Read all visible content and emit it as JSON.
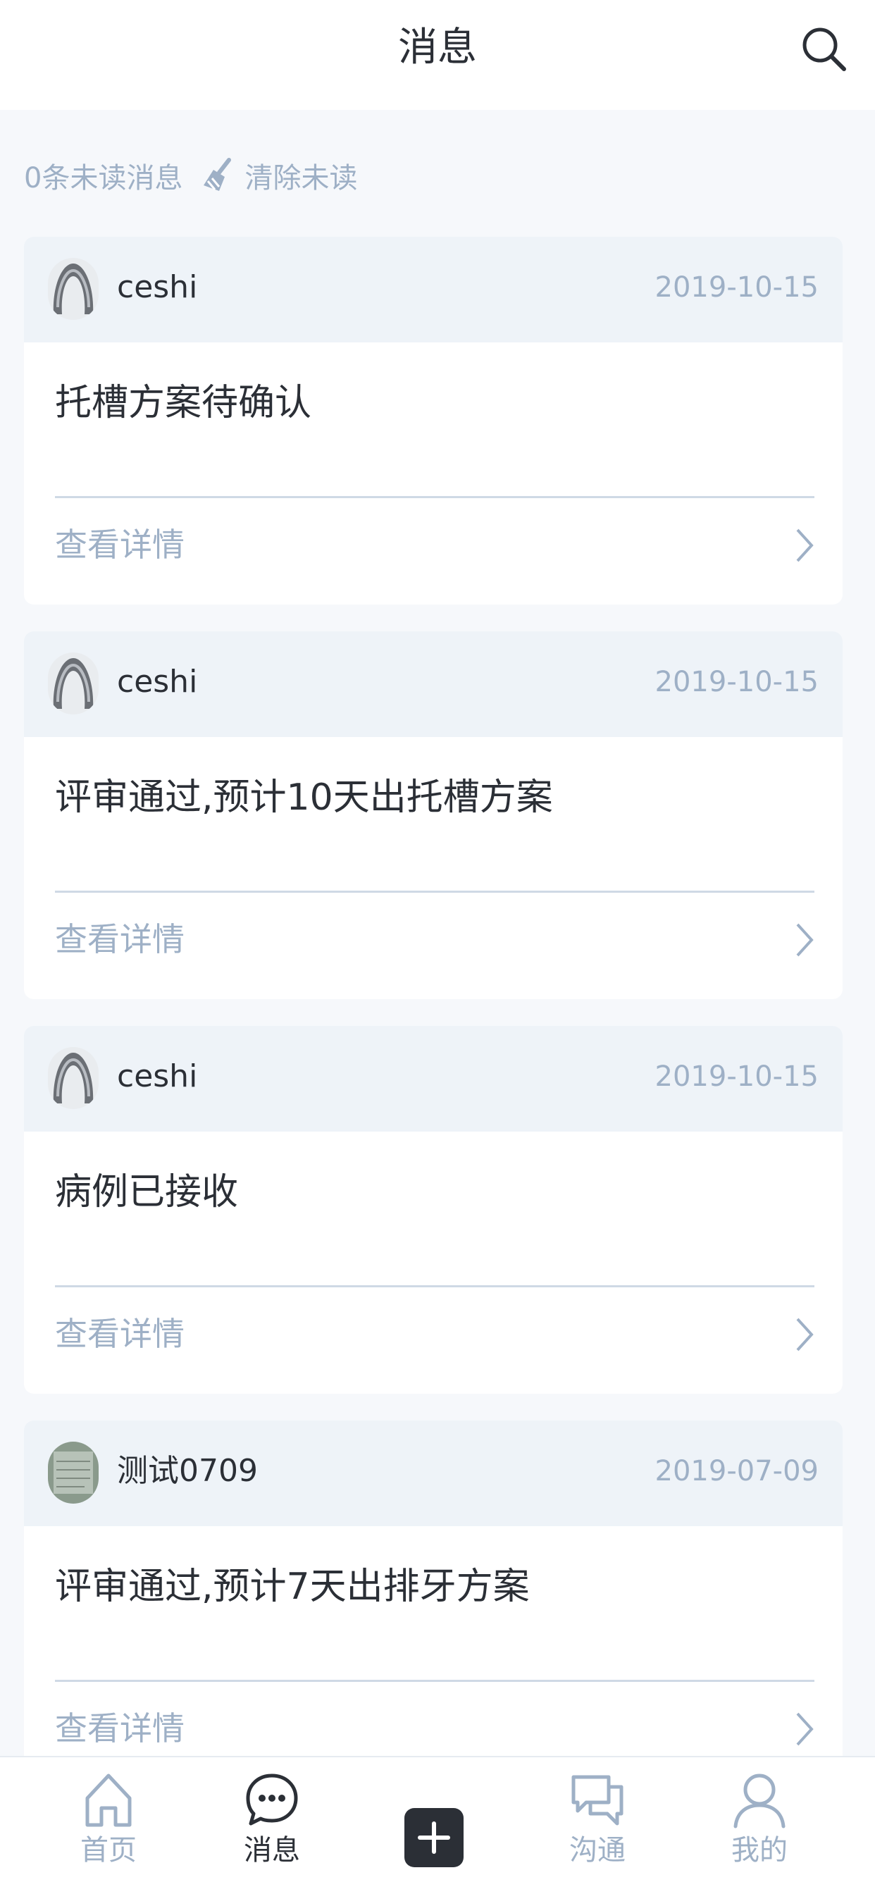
{
  "header": {
    "title": "消息",
    "search_icon": "search-icon"
  },
  "unread": {
    "count_text": "0条未读消息",
    "clear_label": "清除未读",
    "clear_icon": "broom-icon"
  },
  "messages": [
    {
      "sender": "ceshi",
      "date": "2019-10-15",
      "title": "托槽方案待确认",
      "detail_label": "查看详情",
      "avatar": "dental-scan-avatar"
    },
    {
      "sender": "ceshi",
      "date": "2019-10-15",
      "title": "评审通过,预计10天出托槽方案",
      "detail_label": "查看详情",
      "avatar": "dental-scan-avatar"
    },
    {
      "sender": "ceshi",
      "date": "2019-10-15",
      "title": "病例已接收",
      "detail_label": "查看详情",
      "avatar": "dental-scan-avatar"
    },
    {
      "sender": "测试0709",
      "date": "2019-07-09",
      "title": "评审通过,预计7天出排牙方案",
      "detail_label": "查看详情",
      "avatar": "photo-avatar"
    }
  ],
  "tabbar": {
    "items": [
      {
        "label": "首页",
        "icon": "home-icon",
        "active": false
      },
      {
        "label": "消息",
        "icon": "chat-bubble-icon",
        "active": true
      },
      {
        "label": "",
        "icon": "plus-icon",
        "active": false
      },
      {
        "label": "沟通",
        "icon": "conversation-icon",
        "active": false
      },
      {
        "label": "我的",
        "icon": "user-icon",
        "active": false
      }
    ]
  },
  "colors": {
    "accent_text": "#9eb0c6",
    "primary_text": "#2b2f36",
    "card_header_bg": "#eef3f8",
    "page_bg": "#f6f8fb"
  }
}
